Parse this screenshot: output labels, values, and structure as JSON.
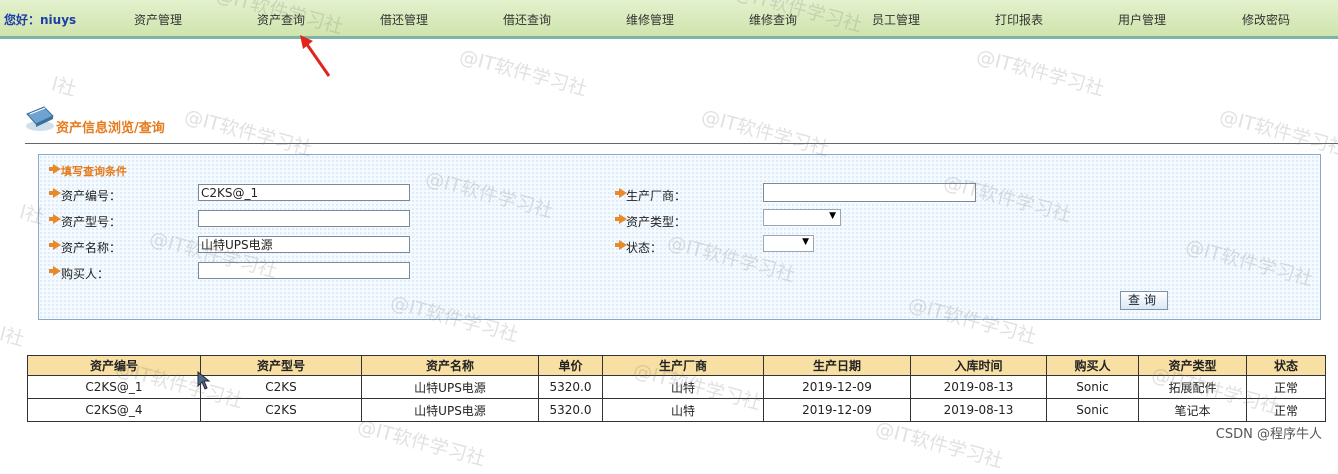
{
  "topnav": {
    "greeting": "您好：niuys",
    "items": [
      {
        "label": "资产管理"
      },
      {
        "label": "资产查询"
      },
      {
        "label": "借还管理"
      },
      {
        "label": "借还查询"
      },
      {
        "label": "维修管理"
      },
      {
        "label": "维修查询"
      },
      {
        "label": "员工管理"
      },
      {
        "label": "打印报表"
      },
      {
        "label": "用户管理"
      },
      {
        "label": "修改密码"
      }
    ]
  },
  "header": {
    "title": "资产信息浏览/查询"
  },
  "query_panel": {
    "title": "填写查询条件",
    "fields": {
      "asset_no": {
        "label": "资产编号：",
        "value": "C2KS@_1"
      },
      "asset_model": {
        "label": "资产型号：",
        "value": ""
      },
      "asset_name": {
        "label": "资产名称：",
        "value": "山特UPS电源"
      },
      "buyer": {
        "label": "购买人：",
        "value": ""
      },
      "manufacturer": {
        "label": "生产厂商：",
        "value": ""
      },
      "asset_type": {
        "label": "资产类型：",
        "value": ""
      },
      "status": {
        "label": "状态：",
        "value": ""
      }
    },
    "button_label": "查询"
  },
  "table": {
    "headers": [
      "资产编号",
      "资产型号",
      "资产名称",
      "单价",
      "生产厂商",
      "生产日期",
      "入库时间",
      "购买人",
      "资产类型",
      "状态"
    ],
    "rows": [
      [
        "C2KS@_1",
        "C2KS",
        "山特UPS电源",
        "5320.0",
        "山特",
        "2019-12-09",
        "2019-08-13",
        "Sonic",
        "拓展配件",
        "正常"
      ],
      [
        "C2KS@_4",
        "C2KS",
        "山特UPS电源",
        "5320.0",
        "山特",
        "2019-12-09",
        "2019-08-13",
        "Sonic",
        "笔记本",
        "正常"
      ]
    ]
  },
  "watermark": {
    "text": "@IT软件学习社",
    "fragment": "l社"
  },
  "footer": {
    "credit": "CSDN @程序牛人"
  },
  "colors": {
    "nav_bg": "#d8eabb",
    "accent_orange": "#e57b1d",
    "table_header_bg": "#f8dfa3",
    "annotation_red": "#e0251b"
  }
}
